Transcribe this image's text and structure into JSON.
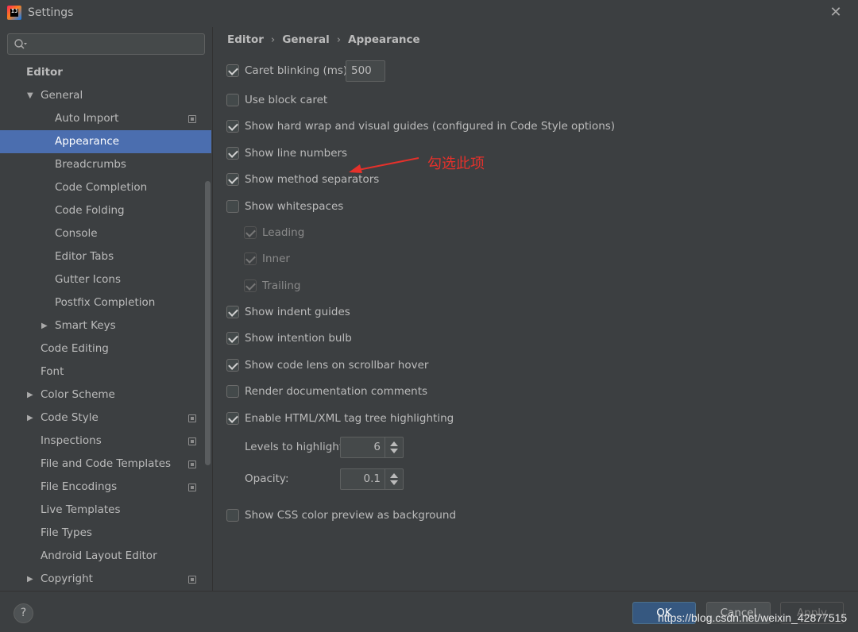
{
  "window": {
    "title": "Settings",
    "app_icon_text": "IJ"
  },
  "sidebar": {
    "search_placeholder": "",
    "items": [
      {
        "label": "Editor",
        "bold": true
      },
      {
        "label": "General",
        "expanded": true
      },
      {
        "label": "Auto Import",
        "project": true
      },
      {
        "label": "Appearance",
        "selected": true
      },
      {
        "label": "Breadcrumbs"
      },
      {
        "label": "Code Completion"
      },
      {
        "label": "Code Folding"
      },
      {
        "label": "Console"
      },
      {
        "label": "Editor Tabs"
      },
      {
        "label": "Gutter Icons"
      },
      {
        "label": "Postfix Completion"
      },
      {
        "label": "Smart Keys",
        "collapsed": true
      },
      {
        "label": "Code Editing"
      },
      {
        "label": "Font"
      },
      {
        "label": "Color Scheme",
        "collapsed": true
      },
      {
        "label": "Code Style",
        "collapsed": true,
        "project": true
      },
      {
        "label": "Inspections",
        "project": true
      },
      {
        "label": "File and Code Templates",
        "project": true
      },
      {
        "label": "File Encodings",
        "project": true
      },
      {
        "label": "Live Templates"
      },
      {
        "label": "File Types"
      },
      {
        "label": "Android Layout Editor"
      },
      {
        "label": "Copyright",
        "collapsed": true,
        "project": true
      }
    ]
  },
  "breadcrumb": [
    "Editor",
    "General",
    "Appearance"
  ],
  "options": {
    "caret_blinking": {
      "label": "Caret blinking (ms):",
      "checked": true,
      "value": "500"
    },
    "block_caret": {
      "label": "Use block caret",
      "checked": false
    },
    "hard_wrap": {
      "label": "Show hard wrap and visual guides (configured in Code Style options)",
      "checked": true
    },
    "line_numbers": {
      "label": "Show line numbers",
      "checked": true
    },
    "method_separators": {
      "label": "Show method separators",
      "checked": true
    },
    "whitespaces": {
      "label": "Show whitespaces",
      "checked": false
    },
    "leading": {
      "label": "Leading",
      "checked": true,
      "disabled": true
    },
    "inner": {
      "label": "Inner",
      "checked": true,
      "disabled": true
    },
    "trailing": {
      "label": "Trailing",
      "checked": true,
      "disabled": true
    },
    "indent_guides": {
      "label": "Show indent guides",
      "checked": true
    },
    "intention_bulb": {
      "label": "Show intention bulb",
      "checked": true
    },
    "code_lens": {
      "label": "Show code lens on scrollbar hover",
      "checked": true
    },
    "render_docs": {
      "label": "Render documentation comments",
      "checked": false
    },
    "tag_tree": {
      "label": "Enable HTML/XML tag tree highlighting",
      "checked": true
    },
    "levels": {
      "label": "Levels to highlight:",
      "value": "6"
    },
    "opacity": {
      "label": "Opacity:",
      "value": "0.1"
    },
    "css_preview": {
      "label": "Show CSS color preview as background",
      "checked": false
    }
  },
  "annotation": {
    "text": "勾选此项",
    "color": "#e5312b"
  },
  "footer": {
    "help_label": "?",
    "ok_label": "OK",
    "cancel_label": "Cancel",
    "apply_label": "Apply",
    "watermark": "https://blog.csdn.net/weixin_42877515"
  },
  "colors": {
    "background": "#3c3f41",
    "selection": "#4b6eaf",
    "ok_button": "#365880"
  }
}
